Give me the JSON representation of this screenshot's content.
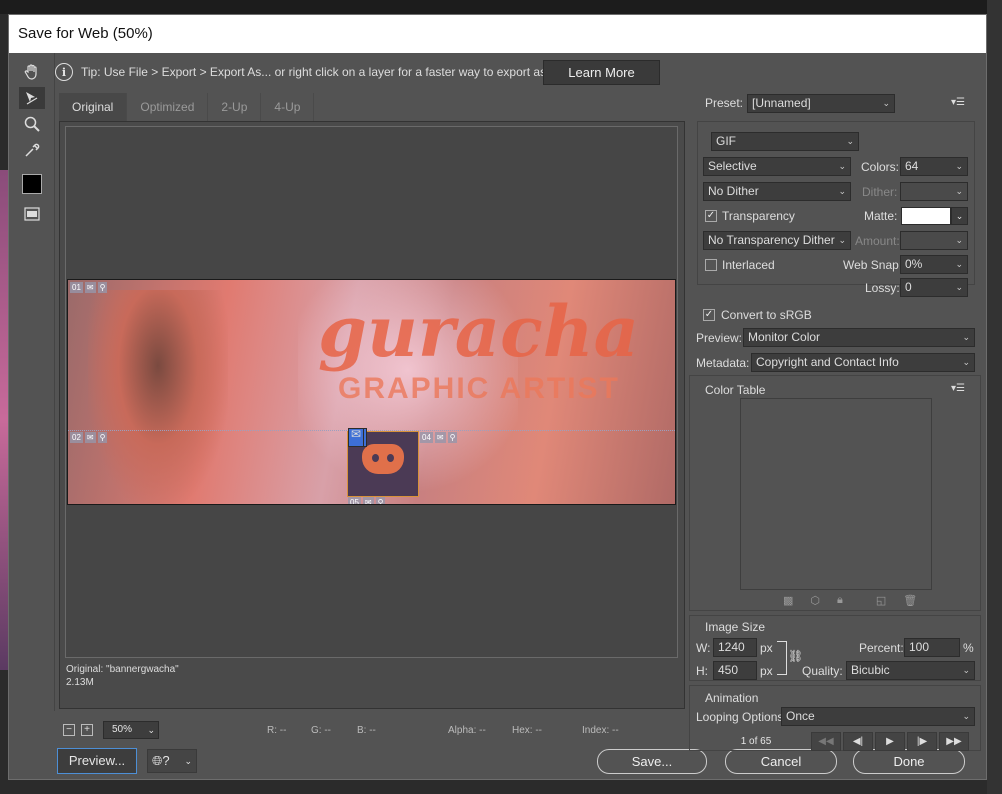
{
  "dialog": {
    "title": "Save for Web (50%)"
  },
  "tip": {
    "icon": "info-icon",
    "text": "Tip: Use File > Export > Export As...  or right click on a layer for a faster way to export assets",
    "learn_more": "Learn More"
  },
  "tabs": [
    {
      "label": "Original"
    },
    {
      "label": "Optimized"
    },
    {
      "label": "2-Up"
    },
    {
      "label": "4-Up"
    }
  ],
  "banner": {
    "title_text": "guracha",
    "subtitle_text": "GRAPHIC ARTIST"
  },
  "slices": {
    "s01": "01",
    "s02": "02",
    "s03": "03",
    "s04": "04",
    "s05": "05"
  },
  "canvas_info": {
    "line1": "Original: \"bannergwacha\"",
    "line2": "2.13M"
  },
  "status": {
    "zoom": "50%",
    "r": "R: --",
    "g": "G: --",
    "b": "B: --",
    "alpha": "Alpha: --",
    "hex": "Hex: --",
    "index": "Index: --"
  },
  "buttons": {
    "preview": "Preview...",
    "save": "Save...",
    "cancel": "Cancel",
    "done": "Done"
  },
  "settings": {
    "preset_label": "Preset:",
    "preset": "[Unnamed]",
    "format": "GIF",
    "reduction": "Selective",
    "colors_label": "Colors:",
    "colors": "64",
    "dither_algo": "No Dither",
    "dither_label": "Dither:",
    "transparency_label": "Transparency",
    "transparency_checked": true,
    "matte_label": "Matte:",
    "matte_color": "#ffffff",
    "transparency_dither": "No Transparency Dither",
    "amount_label": "Amount:",
    "interlaced_label": "Interlaced",
    "interlaced_checked": false,
    "websnap_label": "Web Snap:",
    "websnap": "0%",
    "lossy_label": "Lossy:",
    "lossy": "0",
    "srgb_label": "Convert to sRGB",
    "srgb_checked": true,
    "preview_label": "Preview:",
    "preview": "Monitor Color",
    "metadata_label": "Metadata:",
    "metadata": "Copyright and Contact Info"
  },
  "color_table": {
    "title": "Color Table"
  },
  "image_size": {
    "title": "Image Size",
    "w_label": "W:",
    "w": "1240",
    "h_label": "H:",
    "h": "450",
    "unit": "px",
    "percent_label": "Percent:",
    "percent": "100",
    "percent_unit": "%",
    "quality_label": "Quality:",
    "quality": "Bicubic"
  },
  "animation": {
    "title": "Animation",
    "looping_label": "Looping Options:",
    "looping": "Once",
    "frame": "1 of 65"
  },
  "colors": {
    "accent": "#4d8fd6",
    "dialog_bg": "#535353"
  }
}
